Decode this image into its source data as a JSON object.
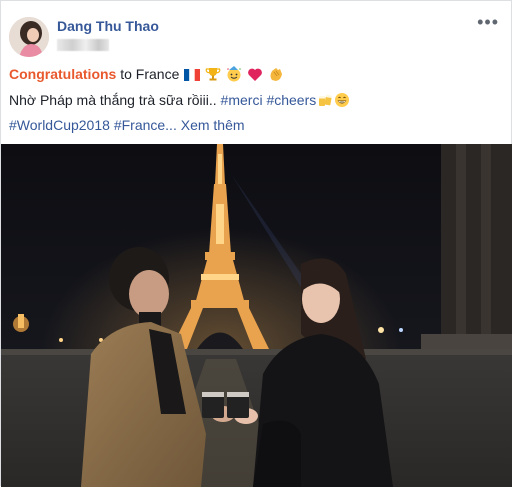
{
  "post": {
    "author": "Dang Thu Thao",
    "line1": {
      "highlight": "Congratulations",
      "rest": " to France "
    },
    "line2": {
      "text": "Nhờ Pháp mà thắng trà sữa rồiii.. ",
      "tag1": "#merci",
      "tag2": "#cheers"
    },
    "line3": {
      "tag1": "#WorldCup2018",
      "tag2": "#France...",
      "see_more": "Xem thêm"
    },
    "more_icon": "more-options-icon",
    "emojis_line1": [
      "france-flag-icon",
      "trophy-icon",
      "party-face-icon",
      "heart-icon",
      "clapping-hands-icon"
    ],
    "emojis_line2": [
      "beer-mugs-icon",
      "grin-icon"
    ]
  },
  "colors": {
    "highlight": "#e9592e",
    "link": "#365899",
    "text": "#1d2129"
  }
}
